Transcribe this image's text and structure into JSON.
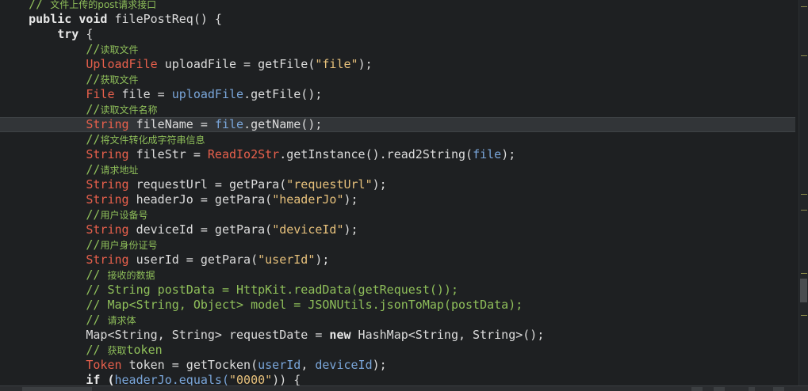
{
  "code": {
    "lines": [
      [
        {
          "t": "    ",
          "c": "plain"
        },
        {
          "t": "// ",
          "c": "cmt"
        },
        {
          "t": "文件上传的post请求接口",
          "c": "cmt-cn"
        }
      ],
      [
        {
          "t": "    ",
          "c": "plain"
        },
        {
          "t": "public void ",
          "c": "kw"
        },
        {
          "t": "filePostReq() {",
          "c": "plain"
        }
      ],
      [
        {
          "t": "        ",
          "c": "plain"
        },
        {
          "t": "try ",
          "c": "kw"
        },
        {
          "t": "{",
          "c": "plain"
        }
      ],
      [
        {
          "t": "            ",
          "c": "plain"
        },
        {
          "t": "//",
          "c": "cmt"
        },
        {
          "t": "读取文件",
          "c": "cmt-cn"
        }
      ],
      [
        {
          "t": "            ",
          "c": "plain"
        },
        {
          "t": "UploadFile ",
          "c": "type"
        },
        {
          "t": "uploadFile = getFile(",
          "c": "plain"
        },
        {
          "t": "\"file\"",
          "c": "str"
        },
        {
          "t": ");",
          "c": "plain"
        }
      ],
      [
        {
          "t": "            ",
          "c": "plain"
        },
        {
          "t": "//",
          "c": "cmt"
        },
        {
          "t": "获取文件",
          "c": "cmt-cn"
        }
      ],
      [
        {
          "t": "            ",
          "c": "plain"
        },
        {
          "t": "File ",
          "c": "type"
        },
        {
          "t": "file = ",
          "c": "plain"
        },
        {
          "t": "uploadFile",
          "c": "fld"
        },
        {
          "t": ".getFile();",
          "c": "plain"
        }
      ],
      [
        {
          "t": "            ",
          "c": "plain"
        },
        {
          "t": "//",
          "c": "cmt"
        },
        {
          "t": "读取文件名称",
          "c": "cmt-cn"
        }
      ],
      [
        {
          "t": "            ",
          "c": "plain"
        },
        {
          "t": "String ",
          "c": "type"
        },
        {
          "t": "fileName = ",
          "c": "plain"
        },
        {
          "t": "file",
          "c": "fld"
        },
        {
          "t": ".getName();",
          "c": "plain"
        }
      ],
      [
        {
          "t": "            ",
          "c": "plain"
        },
        {
          "t": "//",
          "c": "cmt"
        },
        {
          "t": "将文件转化成字符串信息",
          "c": "cmt-cn"
        }
      ],
      [
        {
          "t": "            ",
          "c": "plain"
        },
        {
          "t": "String ",
          "c": "type"
        },
        {
          "t": "fileStr = ",
          "c": "plain"
        },
        {
          "t": "ReadIo2Str",
          "c": "type"
        },
        {
          "t": ".getInstance().read2String(",
          "c": "plain"
        },
        {
          "t": "file",
          "c": "fld"
        },
        {
          "t": ");",
          "c": "plain"
        }
      ],
      [
        {
          "t": "            ",
          "c": "plain"
        },
        {
          "t": "//",
          "c": "cmt"
        },
        {
          "t": "请求地址",
          "c": "cmt-cn"
        }
      ],
      [
        {
          "t": "            ",
          "c": "plain"
        },
        {
          "t": "String ",
          "c": "type"
        },
        {
          "t": "requestUrl = getPara(",
          "c": "plain"
        },
        {
          "t": "\"requestUrl\"",
          "c": "str"
        },
        {
          "t": ");",
          "c": "plain"
        }
      ],
      [
        {
          "t": "            ",
          "c": "plain"
        },
        {
          "t": "String ",
          "c": "type"
        },
        {
          "t": "headerJo = getPara(",
          "c": "plain"
        },
        {
          "t": "\"headerJo\"",
          "c": "str"
        },
        {
          "t": ");",
          "c": "plain"
        }
      ],
      [
        {
          "t": "            ",
          "c": "plain"
        },
        {
          "t": "//",
          "c": "cmt"
        },
        {
          "t": "用户设备号",
          "c": "cmt-cn"
        }
      ],
      [
        {
          "t": "            ",
          "c": "plain"
        },
        {
          "t": "String ",
          "c": "type"
        },
        {
          "t": "deviceId = getPara(",
          "c": "plain"
        },
        {
          "t": "\"deviceId\"",
          "c": "str"
        },
        {
          "t": ");",
          "c": "plain"
        }
      ],
      [
        {
          "t": "            ",
          "c": "plain"
        },
        {
          "t": "//",
          "c": "cmt"
        },
        {
          "t": "用户身份证号",
          "c": "cmt-cn"
        }
      ],
      [
        {
          "t": "            ",
          "c": "plain"
        },
        {
          "t": "String ",
          "c": "type"
        },
        {
          "t": "userId = getPara(",
          "c": "plain"
        },
        {
          "t": "\"userId\"",
          "c": "str"
        },
        {
          "t": ");",
          "c": "plain"
        }
      ],
      [
        {
          "t": "            ",
          "c": "plain"
        },
        {
          "t": "// ",
          "c": "cmt"
        },
        {
          "t": "接收的数据",
          "c": "cmt-cn"
        }
      ],
      [
        {
          "t": "            ",
          "c": "plain"
        },
        {
          "t": "// String postData = HttpKit.readData(getRequest());",
          "c": "cmt"
        }
      ],
      [
        {
          "t": "            ",
          "c": "plain"
        },
        {
          "t": "// Map<String, Object> model = JSONUtils.jsonToMap(postData);",
          "c": "cmt"
        }
      ],
      [
        {
          "t": "            ",
          "c": "plain"
        },
        {
          "t": "// ",
          "c": "cmt"
        },
        {
          "t": "请求体",
          "c": "cmt-cn"
        }
      ],
      [
        {
          "t": "            ",
          "c": "plain"
        },
        {
          "t": "Map<String, String> requestDate = ",
          "c": "plain"
        },
        {
          "t": "new ",
          "c": "kw"
        },
        {
          "t": "HashMap<String, String>();",
          "c": "plain"
        }
      ],
      [
        {
          "t": "            ",
          "c": "plain"
        },
        {
          "t": "// ",
          "c": "cmt"
        },
        {
          "t": "获取",
          "c": "cmt-cn"
        },
        {
          "t": "token",
          "c": "cmt"
        }
      ],
      [
        {
          "t": "            ",
          "c": "plain"
        },
        {
          "t": "Token ",
          "c": "type"
        },
        {
          "t": "token = getTocken(",
          "c": "plain"
        },
        {
          "t": "userId",
          "c": "fld"
        },
        {
          "t": ", ",
          "c": "plain"
        },
        {
          "t": "deviceId",
          "c": "fld"
        },
        {
          "t": ");",
          "c": "plain"
        }
      ],
      [
        {
          "t": "            ",
          "c": "plain"
        },
        {
          "t": "if (",
          "c": "kw"
        },
        {
          "t": "headerJo.equals(",
          "c": "fld"
        },
        {
          "t": "\"0000\"",
          "c": "str"
        },
        {
          "t": ")) {",
          "c": "plain"
        }
      ]
    ],
    "active_line_index": 8
  },
  "colors": {
    "background": "#1e2022",
    "keyword": "#e8e8e8",
    "type": "#e8604c",
    "string": "#e6c07b",
    "field": "#7aa6da",
    "comment": "#8fbf5a"
  }
}
